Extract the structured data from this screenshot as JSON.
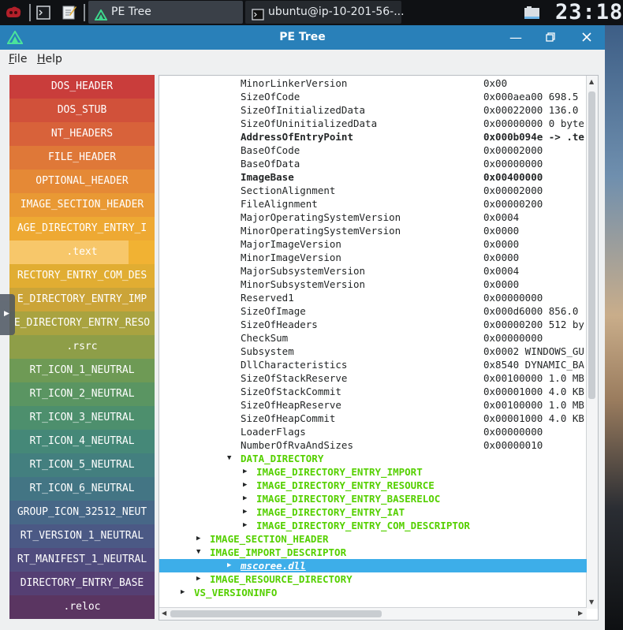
{
  "taskbar": {
    "tasks": [
      {
        "label": "PE Tree",
        "icon": "pe-tree-logo-icon"
      },
      {
        "label": "ubuntu@ip-10-201-56-...",
        "icon": "terminal-icon"
      }
    ],
    "clock": "23:18"
  },
  "window": {
    "title": "PE Tree",
    "menu": [
      {
        "label": "File",
        "mnemonic": "F",
        "rest": "ile"
      },
      {
        "label": "Help",
        "mnemonic": "H",
        "rest": "elp"
      }
    ]
  },
  "sidebar": {
    "blocks": [
      {
        "label": "DOS_HEADER",
        "color": "#c93d3b"
      },
      {
        "label": "DOS_STUB",
        "color": "#d1513a"
      },
      {
        "label": "NT_HEADERS",
        "color": "#d8623a"
      },
      {
        "label": "FILE_HEADER",
        "color": "#df7838"
      },
      {
        "label": "OPTIONAL_HEADER",
        "color": "#e58936"
      },
      {
        "label": "IMAGE_SECTION_HEADER",
        "color": "#e99934"
      },
      {
        "label": "AGE_DIRECTORY_ENTRY_I",
        "color": "#eea933"
      },
      {
        "label": ".text",
        "color": "#f1b233"
      },
      {
        "label": "RECTORY_ENTRY_COM_DES",
        "color": "#e1ad32"
      },
      {
        "label": "E_DIRECTORY_ENTRY_IMP",
        "color": "#cba438"
      },
      {
        "label": "E_DIRECTORY_ENTRY_RESO",
        "color": "#a9a340"
      },
      {
        "label": ".rsrc",
        "color": "#8e9e48"
      },
      {
        "label": "RT_ICON_1_NEUTRAL",
        "color": "#6e9a55"
      },
      {
        "label": "RT_ICON_2_NEUTRAL",
        "color": "#5a9562"
      },
      {
        "label": "RT_ICON_3_NEUTRAL",
        "color": "#4d8f6d"
      },
      {
        "label": "RT_ICON_4_NEUTRAL",
        "color": "#458878"
      },
      {
        "label": "RT_ICON_5_NEUTRAL",
        "color": "#437f7f"
      },
      {
        "label": "RT_ICON_6_NEUTRAL",
        "color": "#437584"
      },
      {
        "label": "GROUP_ICON_32512_NEUT",
        "color": "#476787"
      },
      {
        "label": "RT_VERSION_1_NEUTRAL",
        "color": "#4b5985"
      },
      {
        "label": "RT_MANIFEST_1_NEUTRAL",
        "color": "#504c7e"
      },
      {
        "label": "DIRECTORY_ENTRY_BASE",
        "color": "#553f73"
      },
      {
        "label": ".reloc",
        "color": "#5a3561"
      }
    ]
  },
  "tree": {
    "rows": [
      {
        "name": "MinorLinkerVersion",
        "value": "0x00",
        "style": "field",
        "level": 3
      },
      {
        "name": "SizeOfCode",
        "value": "0x000aea00 698.5",
        "style": "field",
        "level": 3
      },
      {
        "name": "SizeOfInitializedData",
        "value": "0x00022000 136.0",
        "style": "field",
        "level": 3
      },
      {
        "name": "SizeOfUninitializedData",
        "value": "0x00000000 0 byte",
        "style": "field",
        "level": 3
      },
      {
        "name": "AddressOfEntryPoint",
        "value": "0x000b094e -> .te",
        "style": "bold",
        "level": 3
      },
      {
        "name": "BaseOfCode",
        "value": "0x00002000",
        "style": "field",
        "level": 3
      },
      {
        "name": "BaseOfData",
        "value": "0x00000000",
        "style": "field",
        "level": 3
      },
      {
        "name": "ImageBase",
        "value": "0x00400000",
        "style": "bold",
        "level": 3
      },
      {
        "name": "SectionAlignment",
        "value": "0x00002000",
        "style": "field",
        "level": 3
      },
      {
        "name": "FileAlignment",
        "value": "0x00000200",
        "style": "field",
        "level": 3
      },
      {
        "name": "MajorOperatingSystemVersion",
        "value": "0x0004",
        "style": "field",
        "level": 3
      },
      {
        "name": "MinorOperatingSystemVersion",
        "value": "0x0000",
        "style": "field",
        "level": 3
      },
      {
        "name": "MajorImageVersion",
        "value": "0x0000",
        "style": "field",
        "level": 3
      },
      {
        "name": "MinorImageVersion",
        "value": "0x0000",
        "style": "field",
        "level": 3
      },
      {
        "name": "MajorSubsystemVersion",
        "value": "0x0004",
        "style": "field",
        "level": 3
      },
      {
        "name": "MinorSubsystemVersion",
        "value": "0x0000",
        "style": "field",
        "level": 3
      },
      {
        "name": "Reserved1",
        "value": "0x00000000",
        "style": "field",
        "level": 3
      },
      {
        "name": "SizeOfImage",
        "value": "0x000d6000 856.0",
        "style": "field",
        "level": 3
      },
      {
        "name": "SizeOfHeaders",
        "value": "0x00000200 512 by",
        "style": "field",
        "level": 3
      },
      {
        "name": "CheckSum",
        "value": "0x00000000",
        "style": "field",
        "level": 3
      },
      {
        "name": "Subsystem",
        "value": "0x0002 WINDOWS_GU",
        "style": "field",
        "level": 3
      },
      {
        "name": "DllCharacteristics",
        "value": "0x8540 DYNAMIC_BA",
        "style": "field",
        "level": 3
      },
      {
        "name": "SizeOfStackReserve",
        "value": "0x00100000 1.0 MB",
        "style": "field",
        "level": 3
      },
      {
        "name": "SizeOfStackCommit",
        "value": "0x00001000 4.0 KB",
        "style": "field",
        "level": 3
      },
      {
        "name": "SizeOfHeapReserve",
        "value": "0x00100000 1.0 MB",
        "style": "field",
        "level": 3
      },
      {
        "name": "SizeOfHeapCommit",
        "value": "0x00001000 4.0 KB",
        "style": "field",
        "level": 3
      },
      {
        "name": "LoaderFlags",
        "value": "0x00000000",
        "style": "field",
        "level": 3
      },
      {
        "name": "NumberOfRvaAndSizes",
        "value": "0x00000010",
        "style": "field",
        "level": 3
      },
      {
        "name": "DATA_DIRECTORY",
        "value": "",
        "style": "group",
        "expander": "expanded",
        "level": 3
      },
      {
        "name": "IMAGE_DIRECTORY_ENTRY_IMPORT",
        "value": "",
        "style": "group",
        "expander": "collapsed",
        "level": 4
      },
      {
        "name": "IMAGE_DIRECTORY_ENTRY_RESOURCE",
        "value": "",
        "style": "group",
        "expander": "collapsed",
        "level": 4
      },
      {
        "name": "IMAGE_DIRECTORY_ENTRY_BASERELOC",
        "value": "",
        "style": "group",
        "expander": "collapsed",
        "level": 4
      },
      {
        "name": "IMAGE_DIRECTORY_ENTRY_IAT",
        "value": "",
        "style": "group",
        "expander": "collapsed",
        "level": 4
      },
      {
        "name": "IMAGE_DIRECTORY_ENTRY_COM_DESCRIPTOR",
        "value": "",
        "style": "group",
        "expander": "collapsed",
        "level": 4
      },
      {
        "name": "IMAGE_SECTION_HEADER",
        "value": "",
        "style": "group",
        "expander": "collapsed",
        "level": 2
      },
      {
        "name": "IMAGE_IMPORT_DESCRIPTOR",
        "value": "",
        "style": "group",
        "expander": "expanded",
        "level": 2
      },
      {
        "name": "mscoree.dll",
        "value": "",
        "style": "selected",
        "expander": "collapsed",
        "level": 3
      },
      {
        "name": "IMAGE_RESOURCE_DIRECTORY",
        "value": "",
        "style": "group",
        "expander": "collapsed",
        "level": 2
      },
      {
        "name": "VS_VERSIONINFO",
        "value": "",
        "style": "group",
        "expander": "collapsed",
        "level": 1
      }
    ]
  }
}
